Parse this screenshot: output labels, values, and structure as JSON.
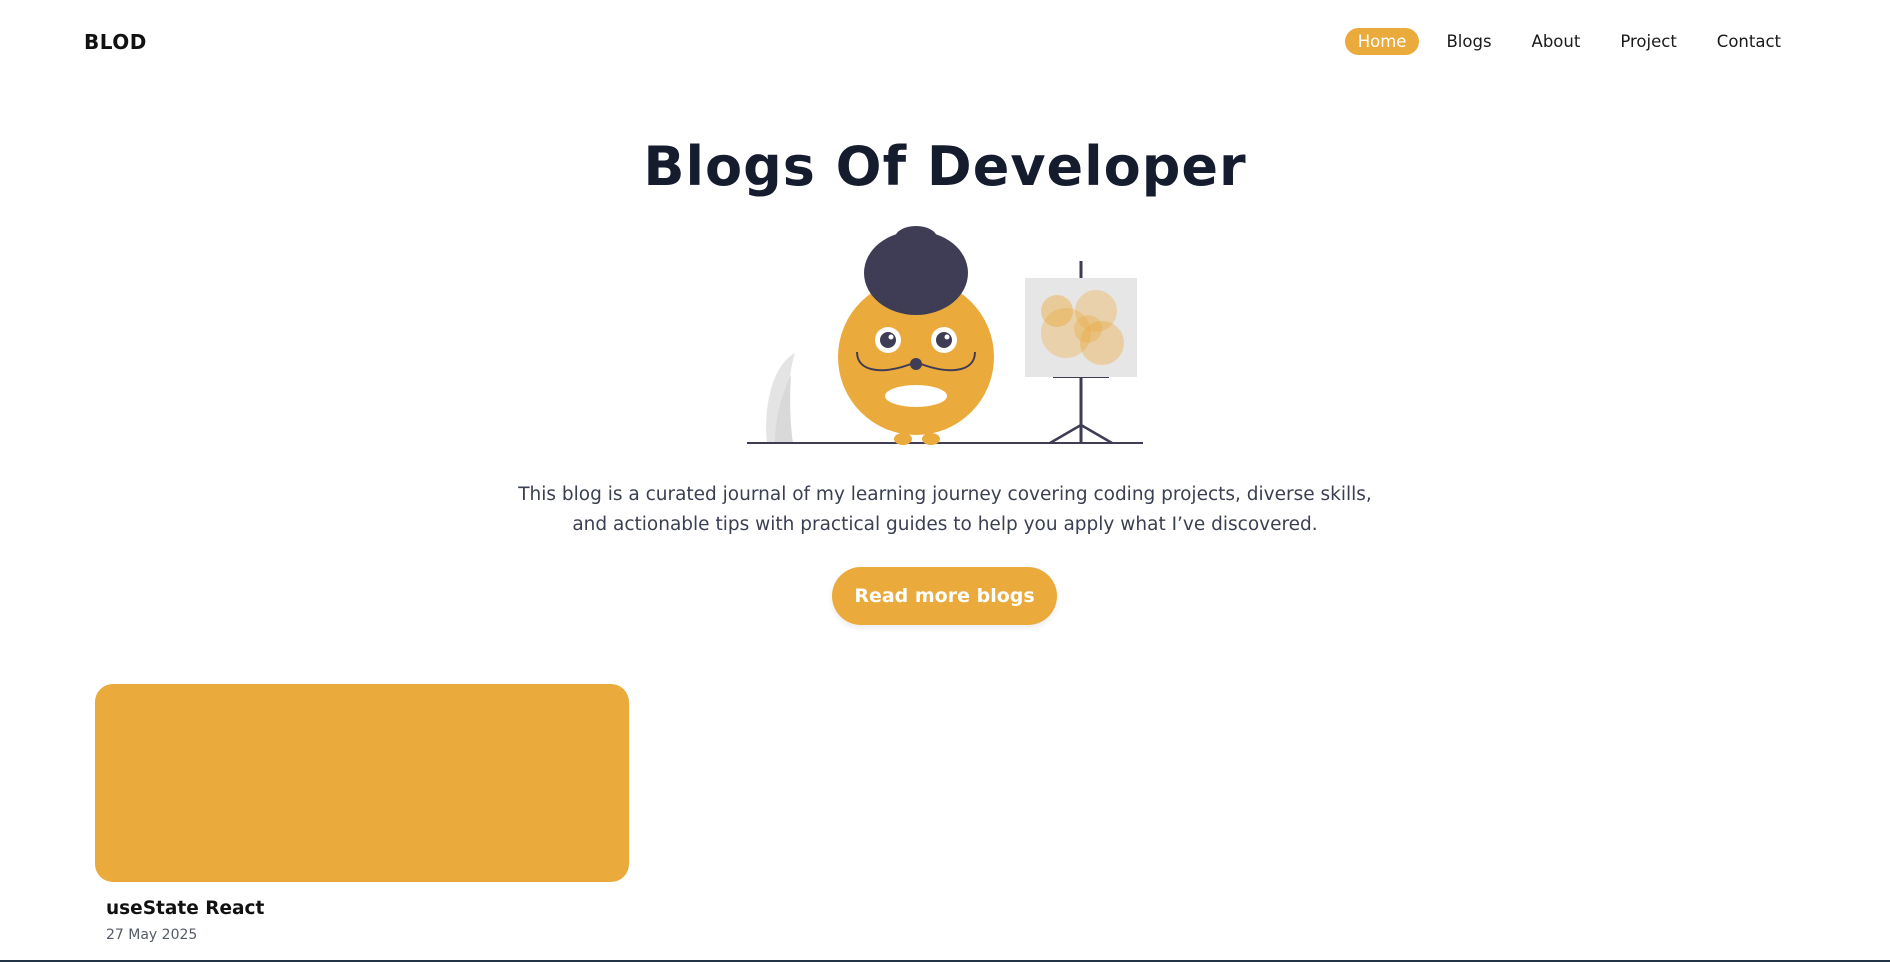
{
  "brand": {
    "name": "BLOD"
  },
  "nav": {
    "items": [
      {
        "label": "Home",
        "active": true
      },
      {
        "label": "Blogs",
        "active": false
      },
      {
        "label": "About",
        "active": false
      },
      {
        "label": "Project",
        "active": false
      },
      {
        "label": "Contact",
        "active": false
      }
    ]
  },
  "hero": {
    "title": "Blogs Of Developer",
    "description_line1": "This blog is a curated journal of my learning journey covering coding projects, diverse skills,",
    "description_line2": "and actionable tips with practical guides to help you apply what I’ve discovered.",
    "cta_label": "Read more blogs"
  },
  "posts": [
    {
      "title": "useState React",
      "date": "27 May 2025"
    }
  ],
  "colors": {
    "accent": "#eaaa3c",
    "title": "#141c2e",
    "character_hair": "#3f3d56"
  },
  "icons": {
    "illustration": "character-painting-illustration"
  }
}
